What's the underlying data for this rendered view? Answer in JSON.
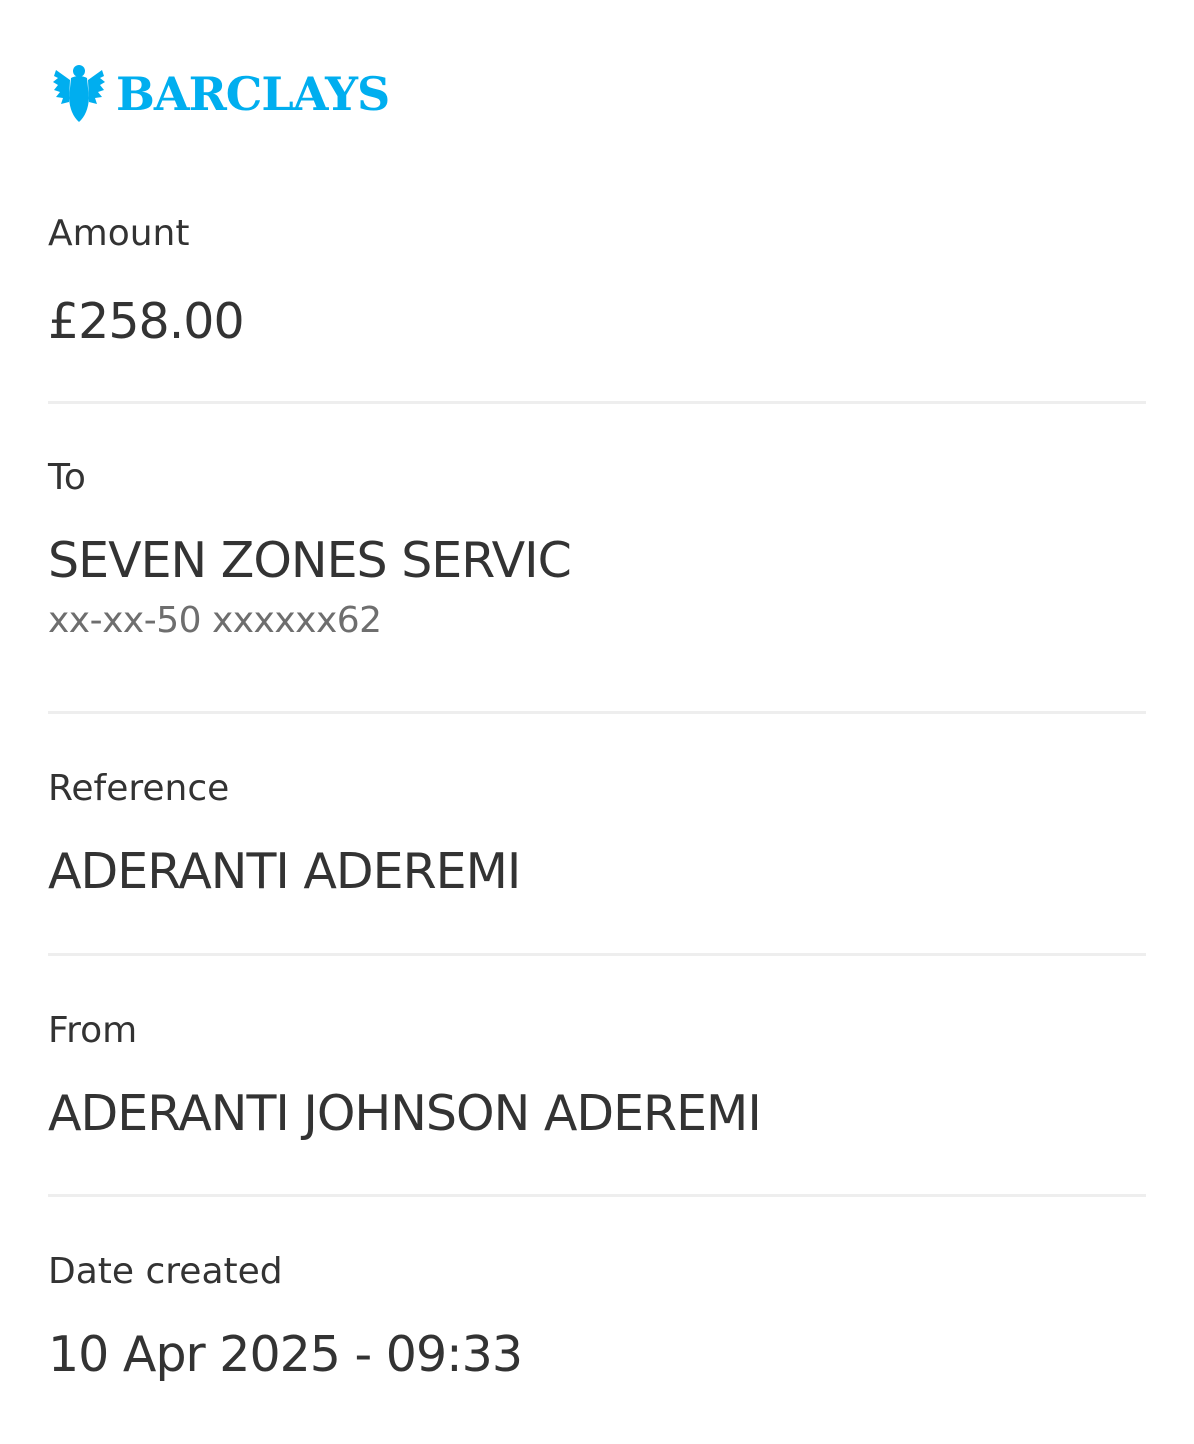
{
  "brand": {
    "name": "BARCLAYS",
    "color": "#00aeef",
    "icon": "eagle-icon"
  },
  "amount": {
    "label": "Amount",
    "value": "£258.00"
  },
  "to": {
    "label": "To",
    "name": "SEVEN ZONES SERVIC",
    "account": "xx-xx-50 xxxxxx62"
  },
  "reference": {
    "label": "Reference",
    "value": "ADERANTI ADEREMI"
  },
  "from": {
    "label": "From",
    "value": "ADERANTI JOHNSON ADEREMI"
  },
  "date_created": {
    "label": "Date created",
    "value": "10 Apr 2025 - 09:33"
  }
}
